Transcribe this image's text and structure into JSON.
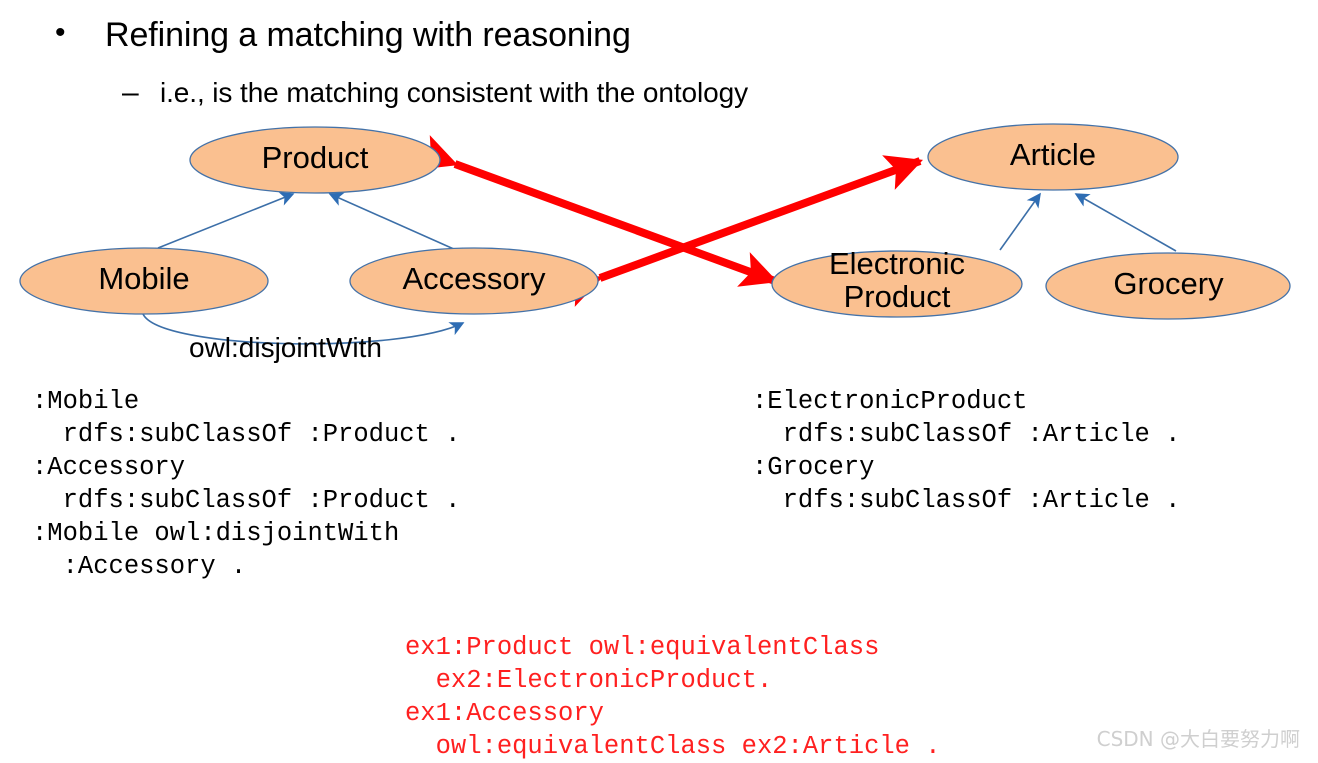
{
  "slide": {
    "bullets": [
      {
        "marker": "•",
        "text": "Refining a matching with reasoning"
      },
      {
        "marker": "–",
        "text": "i.e., is the matching consistent with the ontology"
      }
    ]
  },
  "diagram": {
    "node_fill": "#FAC090",
    "node_stroke": "#4472A8",
    "subclass_color": "#2E6DB4",
    "mapping_color": "#FF0000",
    "nodes": [
      {
        "id": "product",
        "label": "Product"
      },
      {
        "id": "mobile",
        "label": "Mobile"
      },
      {
        "id": "accessory",
        "label": "Accessory"
      },
      {
        "id": "article",
        "label": "Article"
      },
      {
        "id": "electronic-product",
        "label": "Electronic\nProduct"
      },
      {
        "id": "grocery",
        "label": "Grocery"
      }
    ],
    "edge_labels": [
      {
        "id": "disjoint-with",
        "text": "owl:disjointWith"
      }
    ],
    "subclass_edges": [
      {
        "from": "mobile",
        "to": "product"
      },
      {
        "from": "accessory",
        "to": "product"
      },
      {
        "from": "electronic-product",
        "to": "article"
      },
      {
        "from": "grocery",
        "to": "article"
      }
    ],
    "disjoint_edges": [
      {
        "from": "mobile",
        "to": "accessory"
      }
    ],
    "mapping_edges": [
      {
        "from": "product",
        "to": "electronic-product"
      },
      {
        "from": "accessory",
        "to": "article"
      }
    ]
  },
  "code": {
    "left_ontology": ":Mobile\n  rdfs:subClassOf :Product .\n:Accessory\n  rdfs:subClassOf :Product .\n:Mobile owl:disjointWith\n  :Accessory .",
    "right_ontology": ":ElectronicProduct\n  rdfs:subClassOf :Article .\n:Grocery\n  rdfs:subClassOf :Article .",
    "mapping": "ex1:Product owl:equivalentClass\n  ex2:ElectronicProduct.\nex1:Accessory\n  owl:equivalentClass ex2:Article ."
  },
  "watermark": {
    "text": "CSDN @大白要努力啊"
  }
}
